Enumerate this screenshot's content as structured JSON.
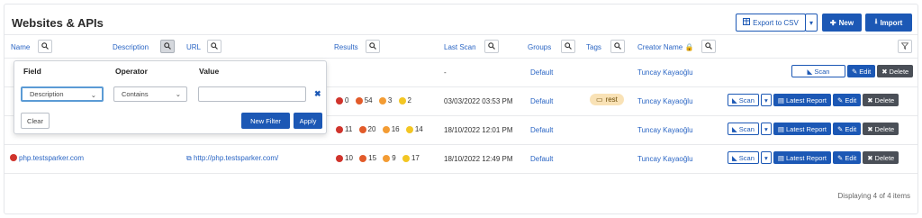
{
  "page": {
    "title": "Websites & APIs"
  },
  "toolbar": {
    "export_label": "Export to CSV",
    "new_label": "New",
    "import_label": "Import"
  },
  "columns": {
    "name": "Name",
    "description": "Description",
    "url": "URL",
    "results": "Results",
    "last_scan": "Last Scan",
    "groups": "Groups",
    "tags": "Tags",
    "creator": "Creator Name"
  },
  "rows": [
    {
      "name": "",
      "url": "",
      "last_scan": "-",
      "group": "Default",
      "tag": "",
      "creator": "Tuncay Kayaoğlu",
      "results": [],
      "actions": {
        "scan": "Scan",
        "report": "",
        "edit": "Edit",
        "delete": "Delete"
      }
    },
    {
      "name": "",
      "url": "",
      "last_scan": "03/03/2022 03:53 PM",
      "group": "Default",
      "tag": "rest",
      "creator": "Tuncay Kayaoğlu",
      "results": [
        "0",
        "54",
        "3",
        "2"
      ],
      "actions": {
        "scan": "Scan",
        "report": "Latest Report",
        "edit": "Edit",
        "delete": "Delete"
      }
    },
    {
      "name": "",
      "url": "",
      "last_scan": "18/10/2022 12:01 PM",
      "group": "Default",
      "tag": "",
      "creator": "Tuncay Kayaoğlu",
      "results": [
        "11",
        "20",
        "16",
        "14"
      ],
      "actions": {
        "scan": "Scan",
        "report": "Latest Report",
        "edit": "Edit",
        "delete": "Delete"
      }
    },
    {
      "name": "php.testsparker.com",
      "url": "http://php.testsparker.com/",
      "last_scan": "18/10/2022 12:49 PM",
      "group": "Default",
      "tag": "",
      "creator": "Tuncay Kayaoğlu",
      "results": [
        "10",
        "15",
        "9",
        "17"
      ],
      "actions": {
        "scan": "Scan",
        "report": "Latest Report",
        "edit": "Edit",
        "delete": "Delete"
      }
    }
  ],
  "footer": {
    "status": "Displaying 4 of 4 items"
  },
  "filter_popup": {
    "field_header": "Field",
    "operator_header": "Operator",
    "value_header": "Value",
    "field_value": "Description",
    "operator_value": "Contains",
    "value_input": "",
    "clear_label": "Clear",
    "new_filter_label": "New Filter",
    "apply_label": "Apply"
  },
  "colors": {
    "accent": "#1c58b5",
    "link": "#2a65c4",
    "critical": "#d0342c",
    "high": "#e25b2a",
    "medium": "#f39c34",
    "low": "#f3c623",
    "tag_bg": "#f9e2b6"
  }
}
